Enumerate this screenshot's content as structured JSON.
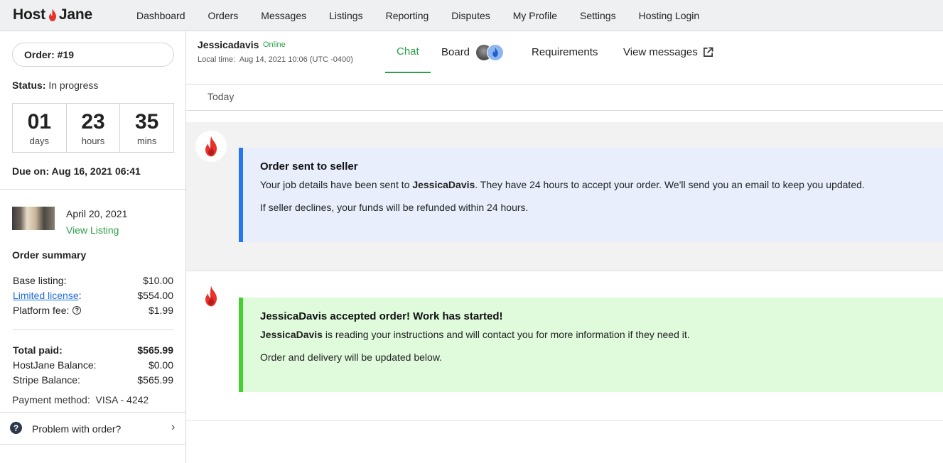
{
  "brand": {
    "name_left": "Host",
    "name_right": "Jane",
    "accent": "#e8322b"
  },
  "nav": [
    "Dashboard",
    "Orders",
    "Messages",
    "Listings",
    "Reporting",
    "Disputes",
    "My Profile",
    "Settings",
    "Hosting Login"
  ],
  "sidebar": {
    "order_label": "Order: #19",
    "status_label": "Status:",
    "status_value": "In progress",
    "countdown": [
      {
        "value": "01",
        "unit": "days"
      },
      {
        "value": "23",
        "unit": "hours"
      },
      {
        "value": "35",
        "unit": "mins"
      }
    ],
    "due": "Due on: Aug 16, 2021 06:41",
    "listing_date": "April 20, 2021",
    "view_listing": "View Listing",
    "summary_title": "Order summary",
    "rows": [
      {
        "label": "Base listing:",
        "value": "$10.00"
      },
      {
        "label": "Limited license",
        "suffix": ":",
        "value": "$554.00"
      },
      {
        "label": "Platform fee:",
        "value": "$1.99"
      }
    ],
    "totals": [
      {
        "label": "Total paid:",
        "value": "$565.99"
      },
      {
        "label": "HostJane Balance:",
        "value": "$0.00"
      },
      {
        "label": "Stripe Balance:",
        "value": "$565.99"
      }
    ],
    "payment_method": "Payment method:  VISA - 4242",
    "problem": "Problem with order?"
  },
  "header": {
    "seller": "Jessicadavis",
    "online": "Online",
    "local_time": "Local time:  Aug 14, 2021 10:06 (UTC -0400)",
    "tabs": [
      "Chat",
      "Board",
      "Requirements",
      "View messages"
    ],
    "active_tab": "Chat"
  },
  "chat": {
    "day": "Today",
    "messages": [
      {
        "title": "Order sent to seller",
        "line1_pre": "Your job details have been sent to ",
        "line1_bold": "JessicaDavis",
        "line1_post": ". They have 24 hours to accept your order. We'll send you an email to keep you updated.",
        "line2": "If seller declines, your funds will be refunded within 24 hours.",
        "accent": "#2577f0"
      },
      {
        "title_bold": "JessicaDavis",
        "title_rest": " accepted order! Work has started!",
        "line1_bold": "JessicaDavis",
        "line1_post": " is reading your instructions and will contact you for more information if they need it.",
        "line2": "Order and delivery will be updated below.",
        "accent": "#44d12e"
      }
    ]
  }
}
